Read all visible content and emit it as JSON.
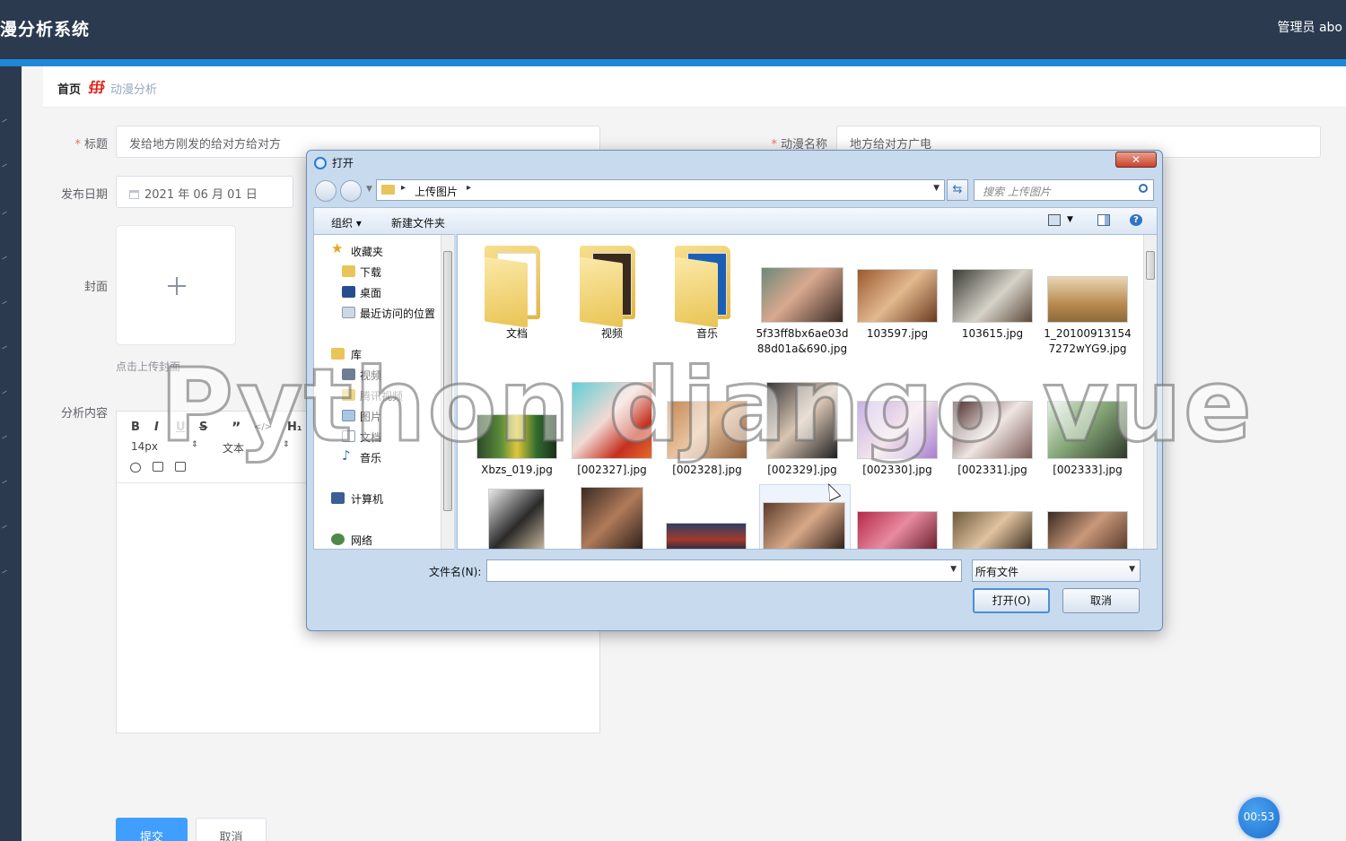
{
  "header": {
    "app_title": "漫分析系统",
    "user": "管理员 abo"
  },
  "breadcrumb": {
    "home": "首页",
    "separator": "∰",
    "current": "动漫分析"
  },
  "form": {
    "title_label": "标题",
    "title_value": "发给地方刚发的给对方给对方",
    "anime_name_label": "动漫名称",
    "anime_name_value": "地方给对方广电",
    "date_label": "发布日期",
    "date_value": "2021 年 06 月 01 日",
    "cover_label": "封面",
    "cover_tip": "点击上传封面",
    "content_label": "分析内容",
    "editor_font_size": "14px",
    "editor_text_type": "文本",
    "submit_label": "提交",
    "cancel_label": "取消"
  },
  "timer": "00:53",
  "dialog": {
    "title": "打开",
    "close_label": "✕",
    "address_path": "上传图片",
    "search_placeholder": "搜索 上传图片",
    "organize_label": "组织",
    "new_folder_label": "新建文件夹",
    "nav": {
      "favorites": "收藏夹",
      "downloads": "下载",
      "desktop": "桌面",
      "recent": "最近访问的位置",
      "library": "库",
      "videos": "视频",
      "tencent_video": "腾讯视频",
      "pictures": "图片",
      "documents": "文档",
      "music": "音乐",
      "computer": "计算机",
      "network": "网络"
    },
    "folders": [
      "文档",
      "视频",
      "音乐"
    ],
    "row1_files": [
      "5f33ff8bx6ae03d88d01a&690.jpg",
      "103597.jpg",
      "103615.jpg",
      "1_201009131547272wYG9.jpg"
    ],
    "row2_files": [
      "Xbzs_019.jpg",
      "[002327].jpg",
      "[002328].jpg",
      "[002329].jpg",
      "[002330].jpg",
      "[002331].jpg",
      "[002333].jpg"
    ],
    "filename_label": "文件名(N):",
    "filename_value": "",
    "filetype": "所有文件",
    "open_label": "打开(O)",
    "cancel_label": "取消"
  },
  "watermark": "Python django vue",
  "colors": {
    "header": "#2b3a4e",
    "accent": "#1e88d8",
    "primary_button": "#409eff",
    "required": "#f56c6c"
  }
}
